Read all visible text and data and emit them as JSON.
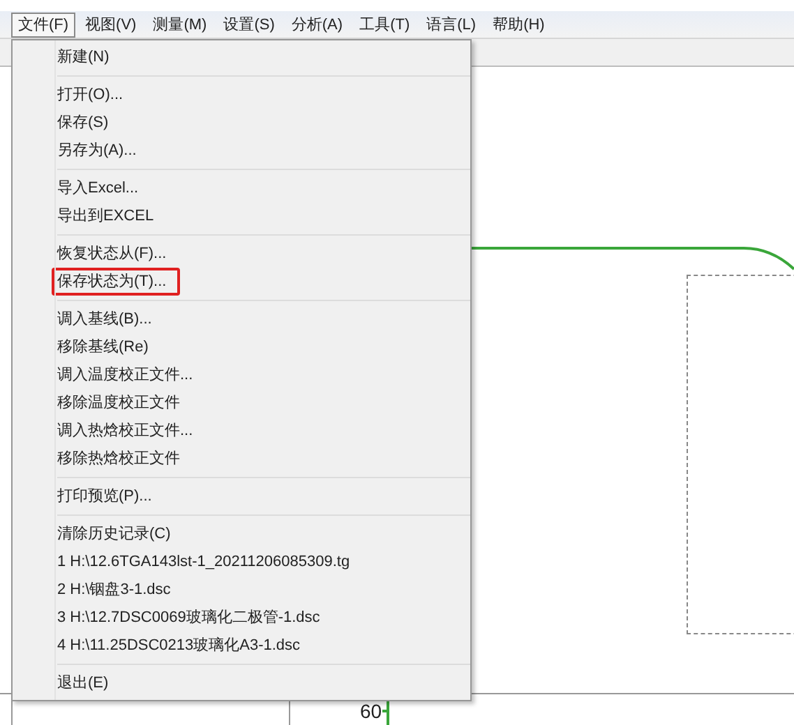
{
  "menubar": [
    {
      "label": "文件(F)",
      "selected": true
    },
    {
      "label": "视图(V)",
      "selected": false
    },
    {
      "label": "测量(M)",
      "selected": false
    },
    {
      "label": "设置(S)",
      "selected": false
    },
    {
      "label": "分析(A)",
      "selected": false
    },
    {
      "label": "工具(T)",
      "selected": false
    },
    {
      "label": "语言(L)",
      "selected": false
    },
    {
      "label": "帮助(H)",
      "selected": false
    }
  ],
  "file_menu": {
    "groups": [
      [
        {
          "label": "新建(N)",
          "highlighted": false
        }
      ],
      [
        {
          "label": "打开(O)...",
          "highlighted": false
        },
        {
          "label": "保存(S)",
          "highlighted": false
        },
        {
          "label": "另存为(A)...",
          "highlighted": false
        }
      ],
      [
        {
          "label": "导入Excel...",
          "highlighted": false
        },
        {
          "label": "导出到EXCEL",
          "highlighted": false
        }
      ],
      [
        {
          "label": "恢复状态从(F)...",
          "highlighted": false
        },
        {
          "label": "保存状态为(T)...",
          "highlighted": true
        }
      ],
      [
        {
          "label": "调入基线(B)...",
          "highlighted": false
        },
        {
          "label": "移除基线(Re)",
          "highlighted": false
        },
        {
          "label": "调入温度校正文件...",
          "highlighted": false
        },
        {
          "label": "移除温度校正文件",
          "highlighted": false
        },
        {
          "label": "调入热焓校正文件...",
          "highlighted": false
        },
        {
          "label": "移除热焓校正文件",
          "highlighted": false
        }
      ],
      [
        {
          "label": "打印预览(P)...",
          "highlighted": false
        }
      ],
      [
        {
          "label": "清除历史记录(C)",
          "highlighted": false
        },
        {
          "label": "1 H:\\12.6TGA143lst-1_20211206085309.tg",
          "highlighted": false
        },
        {
          "label": "2 H:\\铟盘3-1.dsc",
          "highlighted": false
        },
        {
          "label": "3 H:\\12.7DSC0069玻璃化二极管-1.dsc",
          "highlighted": false
        },
        {
          "label": "4 H:\\11.25DSC0213玻璃化A3-1.dsc",
          "highlighted": false
        }
      ],
      [
        {
          "label": "退出(E)",
          "highlighted": false
        }
      ]
    ]
  },
  "plot": {
    "axis_label": "60"
  }
}
